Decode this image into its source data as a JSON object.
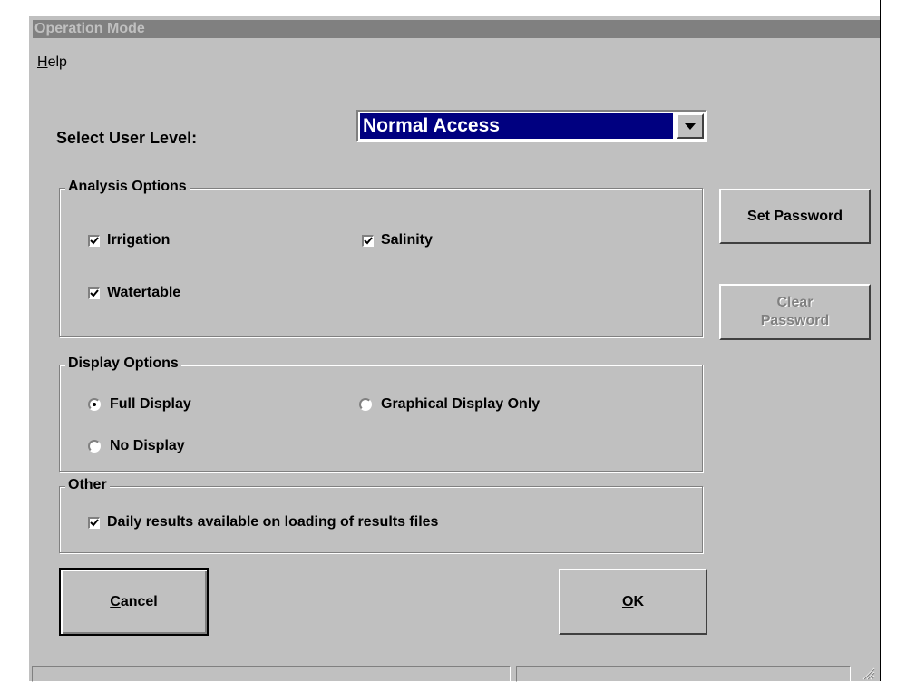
{
  "window": {
    "title": "Operation Mode",
    "menu": [
      {
        "label": "Help",
        "mnemonic": "H",
        "rest": "elp"
      }
    ]
  },
  "user_level": {
    "label": "Select User Level:",
    "value": "Normal Access"
  },
  "analysis_options": {
    "title": "Analysis Options",
    "items": [
      {
        "label": "Irrigation",
        "checked": true
      },
      {
        "label": "Salinity",
        "checked": true
      },
      {
        "label": "Watertable",
        "checked": true
      }
    ]
  },
  "display_options": {
    "title": "Display Options",
    "items": [
      {
        "label": "Full Display",
        "selected": true
      },
      {
        "label": "Graphical Display Only",
        "selected": false
      },
      {
        "label": "No Display",
        "selected": false
      }
    ]
  },
  "other": {
    "title": "Other",
    "items": [
      {
        "label": "Daily results available on loading of results files",
        "checked": true
      }
    ]
  },
  "buttons": {
    "set_password": "Set Password",
    "clear_password_line1": "Clear",
    "clear_password_line2": "Password",
    "cancel_mnemonic": "C",
    "cancel_rest": "ancel",
    "ok_mnemonic": "O",
    "ok_rest": "K"
  },
  "colors": {
    "face": "#c0c0c0",
    "titlebar_inactive": "#808080",
    "selection": "#000080"
  }
}
